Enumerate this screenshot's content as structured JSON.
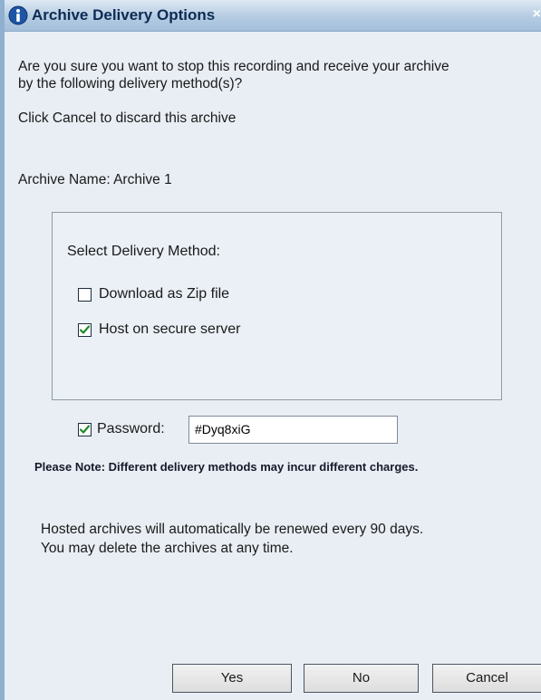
{
  "window": {
    "title": "Archive Delivery Options",
    "close_label": "×"
  },
  "message": {
    "line1": "Are you sure you want to stop this recording and receive your archive",
    "line2": "by the following delivery method(s)?",
    "cancel_hint": "Click Cancel to discard this archive"
  },
  "archive": {
    "name_label": "Archive Name: Archive 1"
  },
  "delivery": {
    "heading": "Select Delivery Method:",
    "options": [
      {
        "label": "Download as Zip file",
        "checked": false
      },
      {
        "label": "Host on secure server",
        "checked": true
      }
    ]
  },
  "password": {
    "label": "Password:",
    "checked": true,
    "value": "#Dyq8xiG"
  },
  "note": {
    "text": "Please Note:  Different delivery methods may incur different charges."
  },
  "hosted_info": {
    "line1": "Hosted archives will automatically be renewed every 90 days.",
    "line2": "You may delete the archives at any time."
  },
  "buttons": {
    "yes": "Yes",
    "no": "No",
    "cancel": "Cancel"
  },
  "icons": {
    "title_icon": "info-icon",
    "check_icon": "checkmark-icon",
    "check_color": "#1f8a2a"
  }
}
